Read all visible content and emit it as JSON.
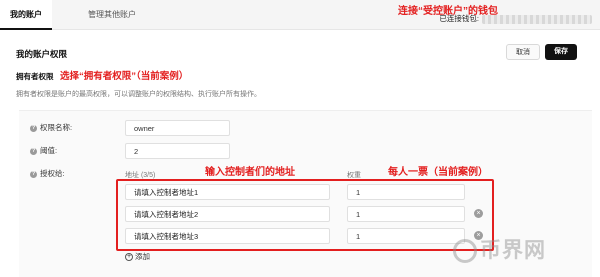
{
  "tabs": [
    {
      "label": "我的账户",
      "active": true
    },
    {
      "label": "管理其他账户",
      "active": false
    }
  ],
  "wallet": {
    "label": "已连接钱包:"
  },
  "annotations": {
    "top": "连接“受控账户”的钱包",
    "owner": "选择“拥有者权限”（当前案例）",
    "addresses": "输入控制者们的地址",
    "votes": "每人一票（当前案例）"
  },
  "section": {
    "title": "我的账户权限",
    "cancel_label": "取消",
    "save_label": "保存"
  },
  "permission": {
    "role": "拥有者权限",
    "description": "拥有者权限是账户的最高权限，可以调整账户的权限结构、执行账户所有操作。"
  },
  "form": {
    "name_label": "权限名称:",
    "name_value": "owner",
    "threshold_label": "阈值:",
    "threshold_value": "2",
    "grant_label": "授权给:",
    "address_header": "地址 (3/5)",
    "weight_header": "权重",
    "rows": [
      {
        "address_placeholder": "请填入控制者地址1",
        "weight": "1",
        "removable": false
      },
      {
        "address_placeholder": "请填入控制者地址2",
        "weight": "1",
        "removable": true
      },
      {
        "address_placeholder": "请填入控制者地址3",
        "weight": "1",
        "removable": true
      }
    ],
    "add_label": "添加"
  },
  "watermark": "币界网",
  "colors": {
    "annotation": "#e31f1f",
    "save_button": "#111111"
  },
  "icons": [
    "question-icon",
    "remove-icon",
    "plus-circle-icon"
  ]
}
